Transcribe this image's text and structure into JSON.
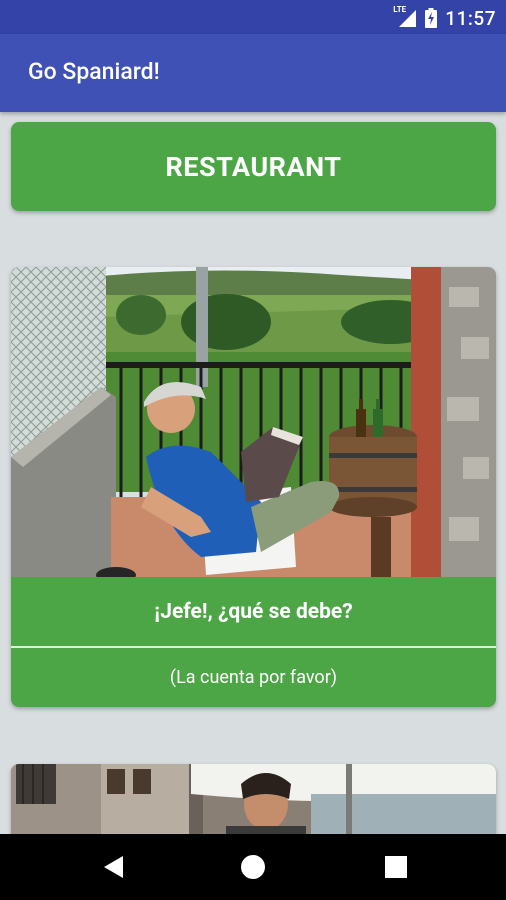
{
  "status_bar": {
    "network": "LTE",
    "time": "11:57",
    "icons": [
      "signal-icon",
      "battery-charging-icon"
    ]
  },
  "app_bar": {
    "title": "Go Spaniard!"
  },
  "category": {
    "label": "RESTAURANT"
  },
  "cards": [
    {
      "image": "photo-man-reading-on-balcony",
      "phrase": "¡Jefe!, ¿qué se debe?",
      "translation": "(La cuenta por favor)"
    },
    {
      "image": "photo-street-cafe-with-umbrella"
    }
  ],
  "nav_bar": {
    "icons": [
      "back-icon",
      "home-icon",
      "recents-icon"
    ]
  },
  "colors": {
    "primary": "#3f51b5",
    "primary_dark": "#3343a8",
    "accent_green": "#4ca645",
    "background": "#d8dde0"
  }
}
